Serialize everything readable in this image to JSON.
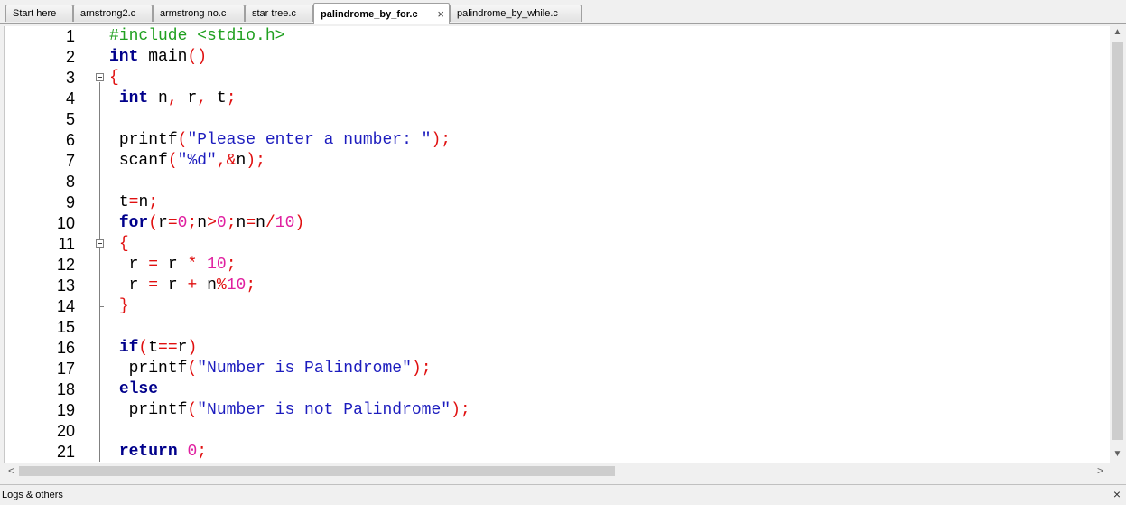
{
  "tabs": [
    {
      "label": "Start here",
      "active": false
    },
    {
      "label": "arnstrong2.c",
      "active": false
    },
    {
      "label": "armstrong no.c",
      "active": false
    },
    {
      "label": "star tree.c",
      "active": false
    },
    {
      "label": "palindrome_by_for.c",
      "active": true
    },
    {
      "label": "palindrome_by_while.c",
      "active": false
    }
  ],
  "tab_close_icon": "×",
  "editor": {
    "line_numbers": [
      "1",
      "2",
      "3",
      "4",
      "5",
      "6",
      "7",
      "8",
      "9",
      "10",
      "11",
      "12",
      "13",
      "14",
      "15",
      "16",
      "17",
      "18",
      "19",
      "20",
      "21"
    ],
    "lines": [
      "#include <stdio.h>",
      "int main()",
      "{",
      " int n, r, t;",
      "",
      " printf(\"Please enter a number: \");",
      " scanf(\"%d\",&n);",
      "",
      " t=n;",
      " for(r=0;n>0;n=n/10)",
      " {",
      "  r = r * 10;",
      "  r = r + n%10;",
      " }",
      "",
      " if(t==r)",
      "  printf(\"Number is Palindrome\");",
      " else",
      "  printf(\"Number is not Palindrome\");",
      "",
      " return 0;"
    ]
  },
  "colors": {
    "keyword": "#00008b",
    "preprocessor": "#20a020",
    "string": "#1c1cbe",
    "number": "#e020a0",
    "operator": "#e01010"
  },
  "bottom_panel": {
    "title": "Logs & others",
    "close_icon": "×"
  },
  "scroll_icons": {
    "up": "▲",
    "down": "▼",
    "left": "<",
    "right": ">"
  }
}
